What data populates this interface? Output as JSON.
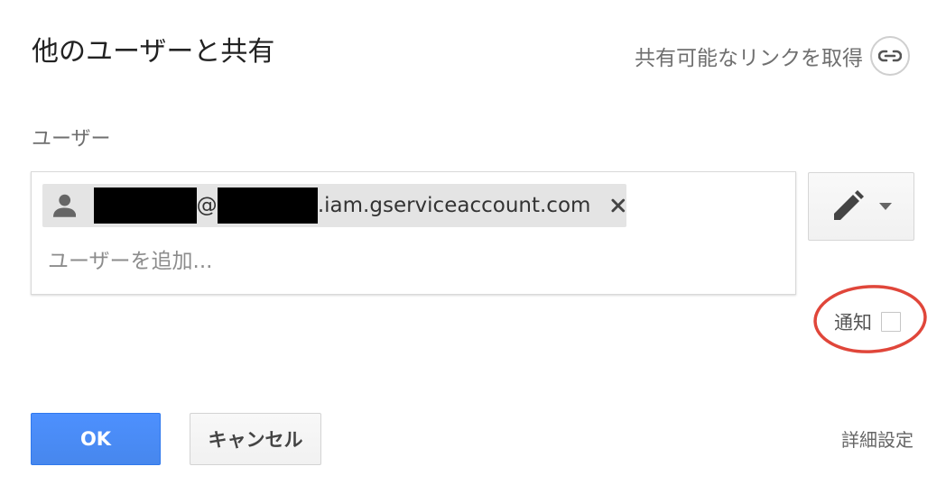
{
  "dialog": {
    "title": "他のユーザーと共有",
    "get_link_label": "共有可能なリンクを取得",
    "users_section_label": "ユーザー",
    "chip": {
      "at_sign": "@",
      "domain_suffix": ".iam.gserviceaccount.com",
      "redacted": true
    },
    "add_user_placeholder": "ユーザーを追加...",
    "permission_icon": "pencil-icon",
    "notify_label": "通知",
    "notify_checked": false,
    "ok_label": "OK",
    "cancel_label": "キャンセル",
    "advanced_label": "詳細設定"
  },
  "colors": {
    "primary_button": "#4d90fe",
    "annotation": "#e0463a",
    "muted_text": "#6f6f6f"
  }
}
